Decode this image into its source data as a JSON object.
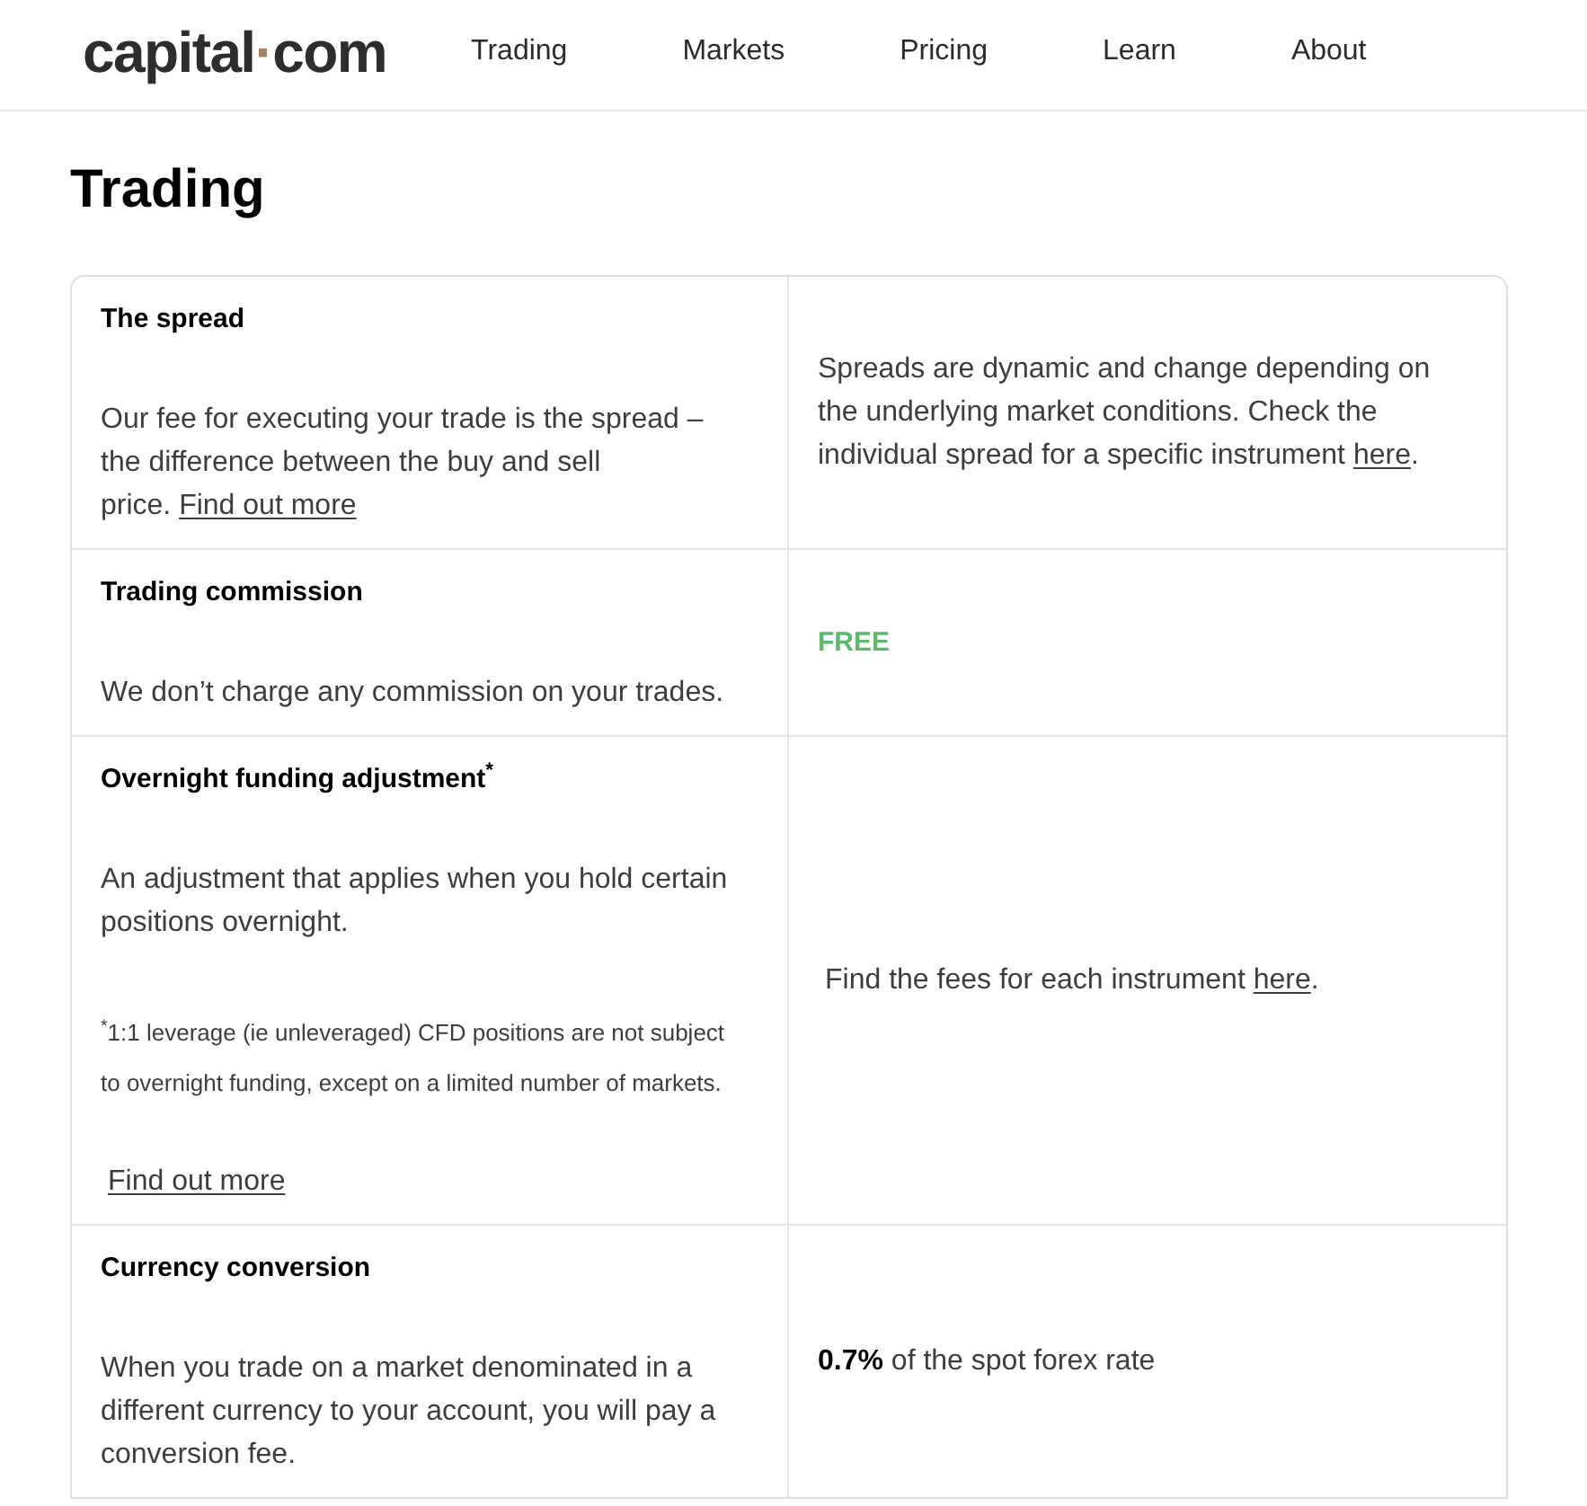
{
  "header": {
    "logo": {
      "name": "capital",
      "separator": "·",
      "tld": "com"
    },
    "nav": [
      "Trading",
      "Markets",
      "Pricing",
      "Learn",
      "About"
    ]
  },
  "page_title": "Trading",
  "fee_table": {
    "rows": [
      {
        "title": "The spread",
        "description": "Our fee for executing your trade is the spread – the difference between the buy and sell price.",
        "description_link": "Find out more",
        "value": {
          "kind": "link_text",
          "text": "Spreads are dynamic and change depending on the underlying market conditions. Check the individual spread for a specific instrument",
          "link": "here",
          "after": "."
        }
      },
      {
        "title": "Trading commission",
        "description": "We don’t charge any commission on your trades.",
        "value": {
          "kind": "highlight",
          "text": "FREE"
        }
      },
      {
        "title": "Overnight funding adjustment$^{*}$",
        "description": "An adjustment that applies when you hold certain positions overnight.",
        "footnote": "$^{*}$1:1 leverage (ie unleveraged) CFD positions are not subject to overnight funding, except on a limited number of markets.",
        "more_link": "Find out more",
        "value": {
          "kind": "link_text",
          "text": "Find the fees for each instrument",
          "link": "here",
          "after": "."
        }
      },
      {
        "title": "Currency conversion",
        "description": "When you trade on a market denominated in a different currency to your account, you will pay a conversion fee.",
        "value": {
          "kind": "rich",
          "text": "**0.7%** of the spot forex rate"
        }
      }
    ]
  }
}
